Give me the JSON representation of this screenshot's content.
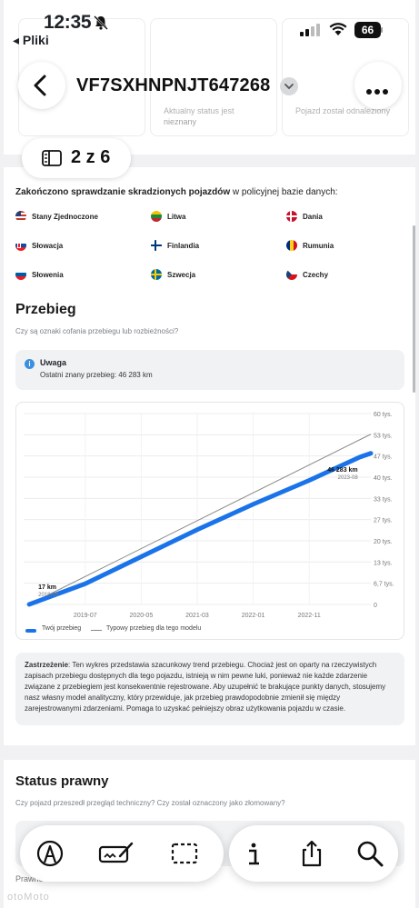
{
  "status_bar": {
    "time": "12:35",
    "back_app": "◂ Pliki",
    "battery": "66"
  },
  "header": {
    "vin": "VF7SXHNPNJT647268",
    "pages": "2 z 6"
  },
  "top_cards": [
    {
      "label": "Aktualny status jest",
      "value": "nieznany"
    },
    {
      "label": "",
      "value": "Pojazd został odnaleziony"
    }
  ],
  "stolen_check": {
    "title_bold": "Zakończono sprawdzanie skradzionych pojazdów",
    "title_rest": " w policyjnej bazie danych:",
    "countries": [
      {
        "name": "Stany Zjednoczone",
        "flag": "us-flag"
      },
      {
        "name": "Litwa",
        "flag": "lt-flag"
      },
      {
        "name": "Dania",
        "flag": "dk-flag"
      },
      {
        "name": "Słowacja",
        "flag": "sk-flag"
      },
      {
        "name": "Finlandia",
        "flag": "fi-flag"
      },
      {
        "name": "Rumunia",
        "flag": "ro-flag"
      },
      {
        "name": "Słowenia",
        "flag": "si-flag"
      },
      {
        "name": "Szwecja",
        "flag": "se-flag"
      },
      {
        "name": "Czechy",
        "flag": "cz-flag"
      }
    ]
  },
  "mileage": {
    "title": "Przebieg",
    "subtitle": "Czy są oznaki cofania przebiegu lub rozbieżności?",
    "alert_title": "Uwaga",
    "alert_text": "Ostatni znany przebieg: 46 283 km",
    "disclaimer_bold": "Zastrzeżenie",
    "disclaimer_text": ": Ten wykres przedstawia szacunkowy trend przebiegu. Chociaż jest on oparty na rzeczywistych zapisach przebiegu dostępnych dla tego pojazdu, istnieją w nim pewne luki, ponieważ nie każde zdarzenie związane z przebiegiem jest konsekwentnie rejestrowane. Aby uzupełnić te brakujące punkty danych, stosujemy nasz własny model analityczny, który przewiduje, jak przebieg prawdopodobnie zmienił się między zarejestrowanymi zdarzeniami. Pomaga to uzyskać pełniejszy obraz użytkowania pojazdu w czasie."
  },
  "chart_data": {
    "type": "line",
    "x_ticks": [
      "2019-07",
      "2020-05",
      "2021-03",
      "2022-01",
      "2022-11"
    ],
    "y_ticks": [
      "0",
      "6,7 tys.",
      "13 tys.",
      "20 tys.",
      "27 tys.",
      "33 tys.",
      "40 tys.",
      "47 tys.",
      "53 tys.",
      "60 tys."
    ],
    "ylim": [
      0,
      60000
    ],
    "xlim": [
      "2018-08",
      "2023-10"
    ],
    "series": [
      {
        "name": "Twój przebieg",
        "color": "#1a73e8",
        "points": [
          [
            "2018-09",
            17
          ],
          [
            "2019-07",
            6500
          ],
          [
            "2020-05",
            15000
          ],
          [
            "2021-03",
            23500
          ],
          [
            "2022-01",
            31500
          ],
          [
            "2022-11",
            39000
          ],
          [
            "2023-08",
            46283
          ],
          [
            "2023-10",
            47500
          ]
        ]
      },
      {
        "name": "Typowy przebieg dla tego modelu",
        "color": "#888888",
        "points": [
          [
            "2018-09",
            0
          ],
          [
            "2023-10",
            53500
          ]
        ]
      }
    ],
    "annotations": [
      {
        "value": "17 km",
        "date": "2018-09"
      },
      {
        "value": "46 283 km",
        "date": "2023-08"
      }
    ]
  },
  "legal": {
    "title": "Status prawny",
    "subtitle": "Czy pojazd przeszedł przegląd techniczny? Czy został oznaczony jako złomowany?",
    "section": "Prawne"
  },
  "watermark": "otoMoto",
  "toolbar": {
    "left": [
      "markup-icon",
      "signature-icon",
      "select-icon"
    ],
    "right": [
      "info-icon",
      "share-icon",
      "search-icon"
    ]
  }
}
